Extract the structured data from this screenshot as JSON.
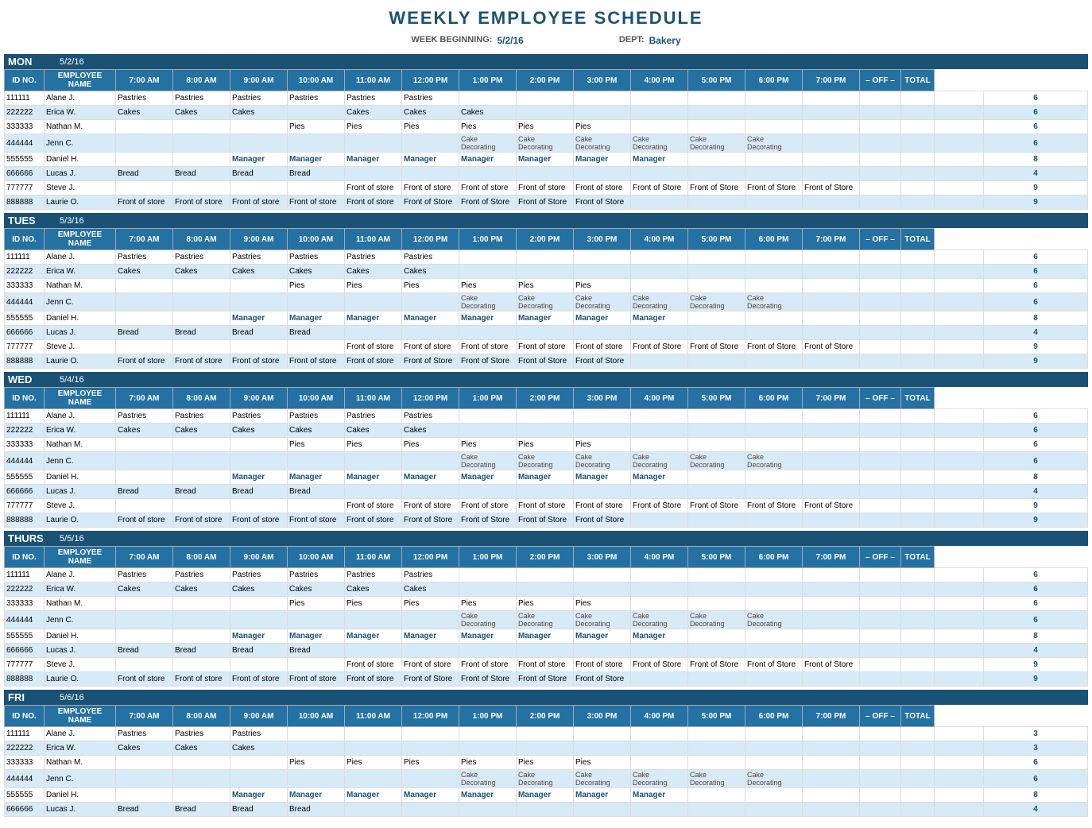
{
  "title": "WEEKLY EMPLOYEE SCHEDULE",
  "meta": {
    "week_label": "WEEK BEGINNING:",
    "week_value": "5/2/16",
    "dept_label": "DEPT:",
    "dept_value": "Bakery"
  },
  "columns": [
    "ID NO.",
    "EMPLOYEE NAME",
    "7:00 AM",
    "8:00 AM",
    "9:00 AM",
    "10:00 AM",
    "11:00 AM",
    "12:00 PM",
    "1:00 PM",
    "2:00 PM",
    "3:00 PM",
    "4:00 PM",
    "5:00 PM",
    "6:00 PM",
    "7:00 PM",
    "– OFF –",
    "TOTAL"
  ],
  "days": [
    {
      "name": "MON",
      "date": "5/2/16",
      "employees": [
        {
          "id": "111111",
          "name": "Alane J.",
          "slots": [
            "Pastries",
            "Pastries",
            "Pastries",
            "Pastries",
            "Pastries",
            "Pastries",
            "",
            "",
            "",
            "",
            "",
            "",
            "",
            "",
            ""
          ],
          "total": 6
        },
        {
          "id": "222222",
          "name": "Erica W.",
          "slots": [
            "Cakes",
            "Cakes",
            "Cakes",
            "",
            "Cakes",
            "Cakes",
            "Cakes",
            "",
            "",
            "",
            "",
            "",
            "",
            "",
            ""
          ],
          "total": 6
        },
        {
          "id": "333333",
          "name": "Nathan M.",
          "slots": [
            "",
            "",
            "",
            "Pies",
            "Pies",
            "Pies",
            "Pies",
            "Pies",
            "Pies",
            "",
            "",
            "",
            "",
            "",
            ""
          ],
          "total": 6
        },
        {
          "id": "444444",
          "name": "Jenn C.",
          "slots": [
            "",
            "",
            "",
            "",
            "",
            "",
            "Cake Decorating",
            "Cake Decorating",
            "Cake Decorating",
            "Cake Decorating",
            "Cake Decorating",
            "Cake Decorating",
            "",
            "",
            ""
          ],
          "total": 6
        },
        {
          "id": "555555",
          "name": "Daniel H.",
          "slots": [
            "",
            "",
            "Manager",
            "Manager",
            "Manager",
            "Manager",
            "Manager",
            "Manager",
            "Manager",
            "Manager",
            "",
            "",
            "",
            "",
            ""
          ],
          "total": 8
        },
        {
          "id": "666666",
          "name": "Lucas J.",
          "slots": [
            "Bread",
            "Bread",
            "Bread",
            "Bread",
            "",
            "",
            "",
            "",
            "",
            "",
            "",
            "",
            "",
            "",
            ""
          ],
          "total": 4
        },
        {
          "id": "777777",
          "name": "Steve J.",
          "slots": [
            "",
            "",
            "",
            "",
            "Front of store",
            "Front of store",
            "Front of store",
            "Front of store",
            "Front of store",
            "Front of Store",
            "Front of Store",
            "Front of Store",
            "Front of Store",
            "",
            ""
          ],
          "total": 9
        },
        {
          "id": "888888",
          "name": "Laurie O.",
          "slots": [
            "Front of store",
            "Front of store",
            "Front of store",
            "Front of store",
            "Front of store",
            "Front of Store",
            "Front of Store",
            "Front of Store",
            "Front of Store",
            "",
            "",
            "",
            "",
            "",
            ""
          ],
          "total": 9
        }
      ]
    },
    {
      "name": "TUES",
      "date": "5/3/16",
      "employees": [
        {
          "id": "111111",
          "name": "Alane J.",
          "slots": [
            "Pastries",
            "Pastries",
            "Pastries",
            "Pastries",
            "Pastries",
            "Pastries",
            "",
            "",
            "",
            "",
            "",
            "",
            "",
            "",
            ""
          ],
          "total": 6
        },
        {
          "id": "222222",
          "name": "Erica W.",
          "slots": [
            "Cakes",
            "Cakes",
            "Cakes",
            "Cakes",
            "Cakes",
            "Cakes",
            "",
            "",
            "",
            "",
            "",
            "",
            "",
            "",
            ""
          ],
          "total": 6
        },
        {
          "id": "333333",
          "name": "Nathan M.",
          "slots": [
            "",
            "",
            "",
            "Pies",
            "Pies",
            "Pies",
            "Pies",
            "Pies",
            "Pies",
            "",
            "",
            "",
            "",
            "",
            ""
          ],
          "total": 6
        },
        {
          "id": "444444",
          "name": "Jenn C.",
          "slots": [
            "",
            "",
            "",
            "",
            "",
            "",
            "Cake Decorating",
            "Cake Decorating",
            "Cake Decorating",
            "Cake Decorating",
            "Cake Decorating",
            "Cake Decorating",
            "",
            "",
            ""
          ],
          "total": 6
        },
        {
          "id": "555555",
          "name": "Daniel H.",
          "slots": [
            "",
            "",
            "Manager",
            "Manager",
            "Manager",
            "Manager",
            "Manager",
            "Manager",
            "Manager",
            "Manager",
            "",
            "",
            "",
            "",
            ""
          ],
          "total": 8
        },
        {
          "id": "666666",
          "name": "Lucas J.",
          "slots": [
            "Bread",
            "Bread",
            "Bread",
            "Bread",
            "",
            "",
            "",
            "",
            "",
            "",
            "",
            "",
            "",
            "",
            ""
          ],
          "total": 4
        },
        {
          "id": "777777",
          "name": "Steve J.",
          "slots": [
            "",
            "",
            "",
            "",
            "Front of store",
            "Front of store",
            "Front of store",
            "Front of store",
            "Front of store",
            "Front of Store",
            "Front of Store",
            "Front of Store",
            "Front of Store",
            "",
            ""
          ],
          "total": 9
        },
        {
          "id": "888888",
          "name": "Laurie O.",
          "slots": [
            "Front of store",
            "Front of store",
            "Front of store",
            "Front of store",
            "Front of store",
            "Front of Store",
            "Front of Store",
            "Front of Store",
            "Front of Store",
            "",
            "",
            "",
            "",
            "",
            ""
          ],
          "total": 9
        }
      ]
    },
    {
      "name": "WED",
      "date": "5/4/16",
      "employees": [
        {
          "id": "111111",
          "name": "Alane J.",
          "slots": [
            "Pastries",
            "Pastries",
            "Pastries",
            "Pastries",
            "Pastries",
            "Pastries",
            "",
            "",
            "",
            "",
            "",
            "",
            "",
            "",
            ""
          ],
          "total": 6
        },
        {
          "id": "222222",
          "name": "Erica W.",
          "slots": [
            "Cakes",
            "Cakes",
            "Cakes",
            "Cakes",
            "Cakes",
            "Cakes",
            "",
            "",
            "",
            "",
            "",
            "",
            "",
            "",
            ""
          ],
          "total": 6
        },
        {
          "id": "333333",
          "name": "Nathan M.",
          "slots": [
            "",
            "",
            "",
            "Pies",
            "Pies",
            "Pies",
            "Pies",
            "Pies",
            "Pies",
            "",
            "",
            "",
            "",
            "",
            ""
          ],
          "total": 6
        },
        {
          "id": "444444",
          "name": "Jenn C.",
          "slots": [
            "",
            "",
            "",
            "",
            "",
            "",
            "Cake Decorating",
            "Cake Decorating",
            "Cake Decorating",
            "Cake Decorating",
            "Cake Decorating",
            "Cake Decorating",
            "",
            "",
            ""
          ],
          "total": 6
        },
        {
          "id": "555555",
          "name": "Daniel H.",
          "slots": [
            "",
            "",
            "Manager",
            "Manager",
            "Manager",
            "Manager",
            "Manager",
            "Manager",
            "Manager",
            "Manager",
            "",
            "",
            "",
            "",
            ""
          ],
          "total": 8
        },
        {
          "id": "666666",
          "name": "Lucas J.",
          "slots": [
            "Bread",
            "Bread",
            "Bread",
            "Bread",
            "",
            "",
            "",
            "",
            "",
            "",
            "",
            "",
            "",
            "",
            ""
          ],
          "total": 4
        },
        {
          "id": "777777",
          "name": "Steve J.",
          "slots": [
            "",
            "",
            "",
            "",
            "Front of store",
            "Front of store",
            "Front of store",
            "Front of store",
            "Front of store",
            "Front of Store",
            "Front of Store",
            "Front of Store",
            "Front of Store",
            "",
            ""
          ],
          "total": 9
        },
        {
          "id": "888888",
          "name": "Laurie O.",
          "slots": [
            "Front of store",
            "Front of store",
            "Front of store",
            "Front of store",
            "Front of store",
            "Front of Store",
            "Front of Store",
            "Front of Store",
            "Front of Store",
            "",
            "",
            "",
            "",
            "",
            ""
          ],
          "total": 9
        }
      ]
    },
    {
      "name": "THURS",
      "date": "5/5/16",
      "employees": [
        {
          "id": "111111",
          "name": "Alane J.",
          "slots": [
            "Pastries",
            "Pastries",
            "Pastries",
            "Pastries",
            "Pastries",
            "Pastries",
            "",
            "",
            "",
            "",
            "",
            "",
            "",
            "",
            ""
          ],
          "total": 6
        },
        {
          "id": "222222",
          "name": "Erica W.",
          "slots": [
            "Cakes",
            "Cakes",
            "Cakes",
            "Cakes",
            "Cakes",
            "Cakes",
            "",
            "",
            "",
            "",
            "",
            "",
            "",
            "",
            ""
          ],
          "total": 6
        },
        {
          "id": "333333",
          "name": "Nathan M.",
          "slots": [
            "",
            "",
            "",
            "Pies",
            "Pies",
            "Pies",
            "Pies",
            "Pies",
            "Pies",
            "",
            "",
            "",
            "",
            "",
            ""
          ],
          "total": 6
        },
        {
          "id": "444444",
          "name": "Jenn C.",
          "slots": [
            "",
            "",
            "",
            "",
            "",
            "",
            "Cake Decorating",
            "Cake Decorating",
            "Cake Decorating",
            "Cake Decorating",
            "Cake Decorating",
            "Cake Decorating",
            "",
            "",
            ""
          ],
          "total": 6
        },
        {
          "id": "555555",
          "name": "Daniel H.",
          "slots": [
            "",
            "",
            "Manager",
            "Manager",
            "Manager",
            "Manager",
            "Manager",
            "Manager",
            "Manager",
            "Manager",
            "",
            "",
            "",
            "",
            ""
          ],
          "total": 8
        },
        {
          "id": "666666",
          "name": "Lucas J.",
          "slots": [
            "Bread",
            "Bread",
            "Bread",
            "Bread",
            "",
            "",
            "",
            "",
            "",
            "",
            "",
            "",
            "",
            "",
            ""
          ],
          "total": 4
        },
        {
          "id": "777777",
          "name": "Steve J.",
          "slots": [
            "",
            "",
            "",
            "",
            "Front of store",
            "Front of store",
            "Front of store",
            "Front of store",
            "Front of store",
            "Front of Store",
            "Front of Store",
            "Front of Store",
            "Front of Store",
            "",
            ""
          ],
          "total": 9
        },
        {
          "id": "888888",
          "name": "Laurie O.",
          "slots": [
            "Front of store",
            "Front of store",
            "Front of store",
            "Front of store",
            "Front of store",
            "Front of Store",
            "Front of Store",
            "Front of Store",
            "Front of Store",
            "",
            "",
            "",
            "",
            "",
            ""
          ],
          "total": 9
        }
      ]
    },
    {
      "name": "FRI",
      "date": "5/6/16",
      "employees": [
        {
          "id": "111111",
          "name": "Alane J.",
          "slots": [
            "Pastries",
            "Pastries",
            "Pastries",
            "",
            "",
            "",
            "",
            "",
            "",
            "",
            "",
            "",
            "",
            "",
            ""
          ],
          "total": 3
        },
        {
          "id": "222222",
          "name": "Erica W.",
          "slots": [
            "Cakes",
            "Cakes",
            "Cakes",
            "",
            "",
            "",
            "",
            "",
            "",
            "",
            "",
            "",
            "",
            "",
            ""
          ],
          "total": 3
        },
        {
          "id": "333333",
          "name": "Nathan M.",
          "slots": [
            "",
            "",
            "",
            "Pies",
            "Pies",
            "Pies",
            "Pies",
            "Pies",
            "Pies",
            "",
            "",
            "",
            "",
            "",
            ""
          ],
          "total": 6
        },
        {
          "id": "444444",
          "name": "Jenn C.",
          "slots": [
            "",
            "",
            "",
            "",
            "",
            "",
            "Cake Decorating",
            "Cake Decorating",
            "Cake Decorating",
            "Cake Decorating",
            "Cake Decorating",
            "Cake Decorating",
            "",
            "",
            ""
          ],
          "total": 6
        },
        {
          "id": "555555",
          "name": "Daniel H.",
          "slots": [
            "",
            "",
            "Manager",
            "Manager",
            "Manager",
            "Manager",
            "Manager",
            "Manager",
            "Manager",
            "Manager",
            "",
            "",
            "",
            "",
            ""
          ],
          "total": 8
        },
        {
          "id": "666666",
          "name": "Lucas J.",
          "slots": [
            "Bread",
            "Bread",
            "Bread",
            "Bread",
            "",
            "",
            "",
            "",
            "",
            "",
            "",
            "",
            "",
            "",
            ""
          ],
          "total": 4
        }
      ]
    }
  ]
}
